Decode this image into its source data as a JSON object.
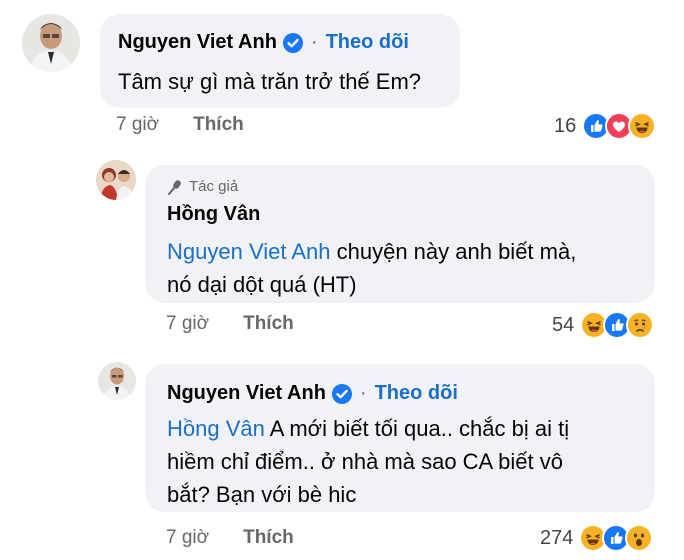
{
  "comments": [
    {
      "author": "Nguyen Viet Anh",
      "follow_label": "Theo dõi",
      "dot": "·",
      "mention": "",
      "text": "Tâm sự gì mà trăn trở thế Em?",
      "time": "7 giờ",
      "like_label": "Thích",
      "reaction_count": "16",
      "reactions": [
        "like-icon",
        "love-icon",
        "haha-icon"
      ]
    },
    {
      "author_badge": "Tác giả",
      "author": "Hồng Vân",
      "mention": "Nguyen Viet Anh",
      "text_line1": " chuyện này anh biết mà,",
      "text_line2": "nó dại dột quá (HT)",
      "time": "7 giờ",
      "like_label": "Thích",
      "reaction_count": "54",
      "reactions": [
        "haha-icon",
        "like-icon",
        "sad-icon"
      ]
    },
    {
      "author": "Nguyen Viet Anh",
      "follow_label": "Theo dõi",
      "dot": "·",
      "mention": "Hồng Vân",
      "text_line1": " A mới biết tối qua.. chắc bị ai tị",
      "text_line2": "hiềm chỉ điểm.. ở nhà mà sao CA biết vô",
      "text_line3": "bắt? Bạn với bè hic",
      "time": "7 giờ",
      "like_label": "Thích",
      "reaction_count": "274",
      "reactions": [
        "haha-icon",
        "like-icon",
        "wow-icon"
      ]
    }
  ],
  "colors": {
    "bubble": "#f0f2f5",
    "link": "#1a6fc9",
    "verified": "#1877f2",
    "meta": "#65676b"
  }
}
